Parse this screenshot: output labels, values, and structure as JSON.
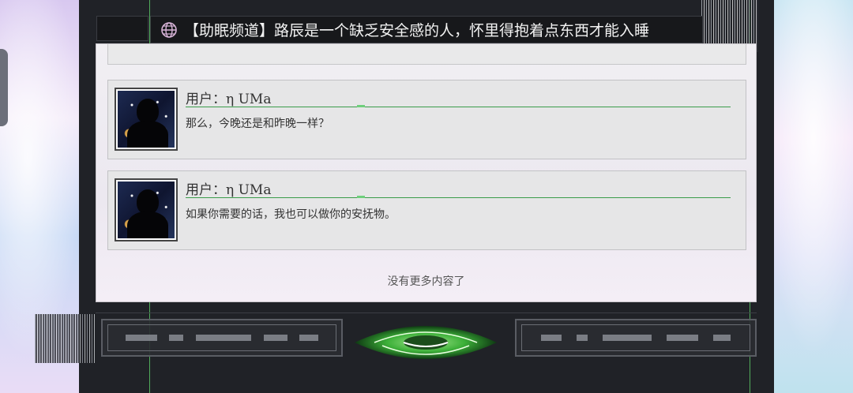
{
  "header": {
    "title": "【助眠频道】路辰是一个缺乏安全感的人，怀里得抱着点东西才能入睡",
    "icon": "globe-icon"
  },
  "messages": [
    {
      "user": "用户：η UMa",
      "text": "那么，今晚还是和昨晚一样？"
    },
    {
      "user": "用户：η UMa",
      "text": "如果你需要的话，我也可以做你的安抚物。"
    }
  ],
  "footer": {
    "no_more_text": "没有更多内容了"
  },
  "colors": {
    "accent_green": "#5fd16a",
    "panel_bg": "#ece8f0",
    "title_bg": "#17181b"
  }
}
